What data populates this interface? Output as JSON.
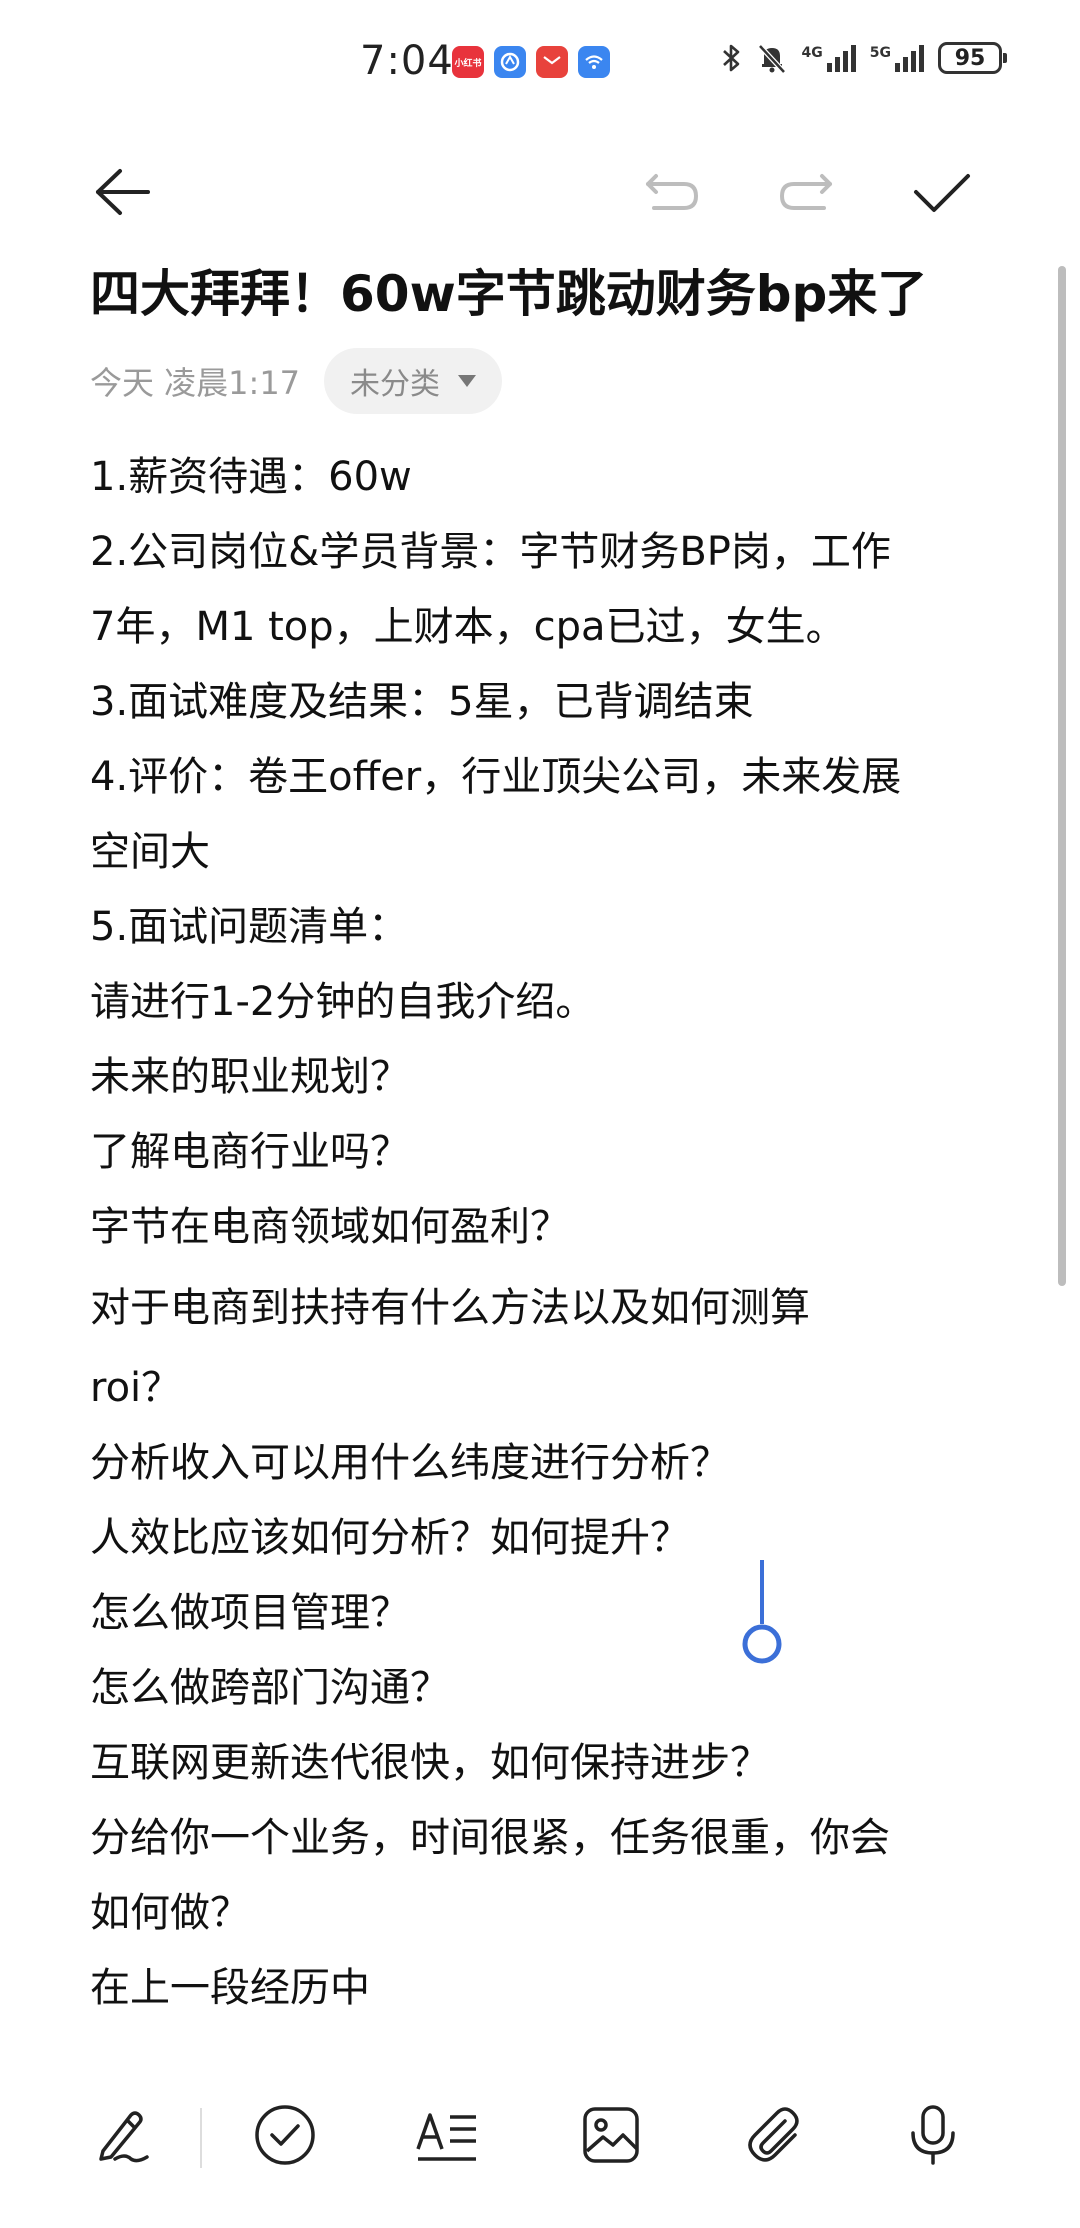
{
  "status_bar": {
    "time": "7:04",
    "battery": "95",
    "network_1": "4G",
    "network_2": "5G",
    "notification_apps": [
      {
        "name": "xiaohongshu",
        "color": "#e8333c",
        "label": "小红书"
      },
      {
        "name": "browser",
        "color": "#3b86f0",
        "label": ""
      },
      {
        "name": "huawei-mail",
        "color": "#e8423c",
        "label": ""
      },
      {
        "name": "wifi-app",
        "color": "#3b86f0",
        "label": ""
      }
    ]
  },
  "toolbar": {
    "back_icon": "arrow-left-icon",
    "undo_icon": "undo-icon",
    "redo_icon": "redo-icon",
    "confirm_icon": "check-icon"
  },
  "note": {
    "title": "四大拜拜！60w字节跳动财务bp来了",
    "date": "今天 凌晨1:17",
    "category": "未分类",
    "lines": [
      "1.薪资待遇：60w",
      "2.公司岗位&学员背景：字节财务BP岗，工作",
      "7年，M1 top，上财本，cpa已过，女生。",
      "3.面试难度及结果：5星，已背调结束",
      "4.评价：卷王offer，行业顶尖公司，未来发展",
      "空间大",
      "5.面试问题清单：",
      "请进行1-2分钟的自我介绍。",
      "未来的职业规划？",
      "了解电商行业吗？",
      "字节在电商领域如何盈利？",
      "对于电商到扶持有什么方法以及如何测算",
      "roi？",
      "分析收入可以用什么纬度进行分析？",
      "人效比应该如何分析？如何提升？",
      "怎么做项目管理？",
      "怎么做跨部门沟通？",
      "互联网更新迭代很快，如何保持进步？",
      "分给你一个业务，时间很紧，任务很重，你会",
      "如何做？",
      "在上一段经历中"
    ]
  },
  "bottom_bar": {
    "icons": [
      "handwriting-icon",
      "checklist-icon",
      "text-format-icon",
      "image-icon",
      "attachment-icon",
      "microphone-icon"
    ]
  },
  "colors": {
    "accent": "#3b6fd8",
    "meta_gray": "#9a9a9a",
    "chip_bg": "#f1f1f1"
  }
}
